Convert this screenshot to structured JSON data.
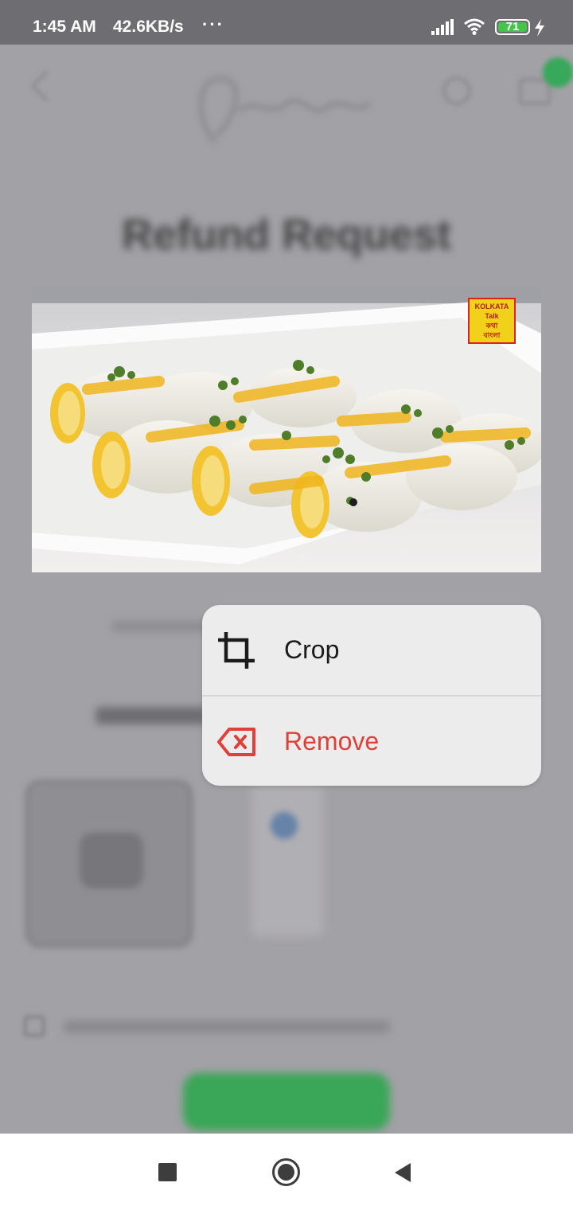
{
  "status_bar": {
    "time": "1:45 AM",
    "network_speed": "42.6KB/s",
    "more_indicator": "···",
    "battery_level": "71",
    "icons": [
      "signal-icon",
      "wifi-icon",
      "battery-icon",
      "charging-icon"
    ]
  },
  "background_page": {
    "title": "Refund Request",
    "blurred": true
  },
  "preview_image": {
    "description_icon": "food-photo",
    "watermark": [
      "KOLKATA",
      "Talk",
      "কথা",
      "বাংলা"
    ]
  },
  "context_menu": {
    "items": [
      {
        "label": "Crop",
        "icon": "crop-icon",
        "color": "#1b1b1b"
      },
      {
        "label": "Remove",
        "icon": "backspace-x-icon",
        "color": "#e0403a"
      }
    ]
  },
  "nav_bar": {
    "icons": [
      "recents-square-icon",
      "home-circle-icon",
      "back-triangle-icon"
    ]
  }
}
